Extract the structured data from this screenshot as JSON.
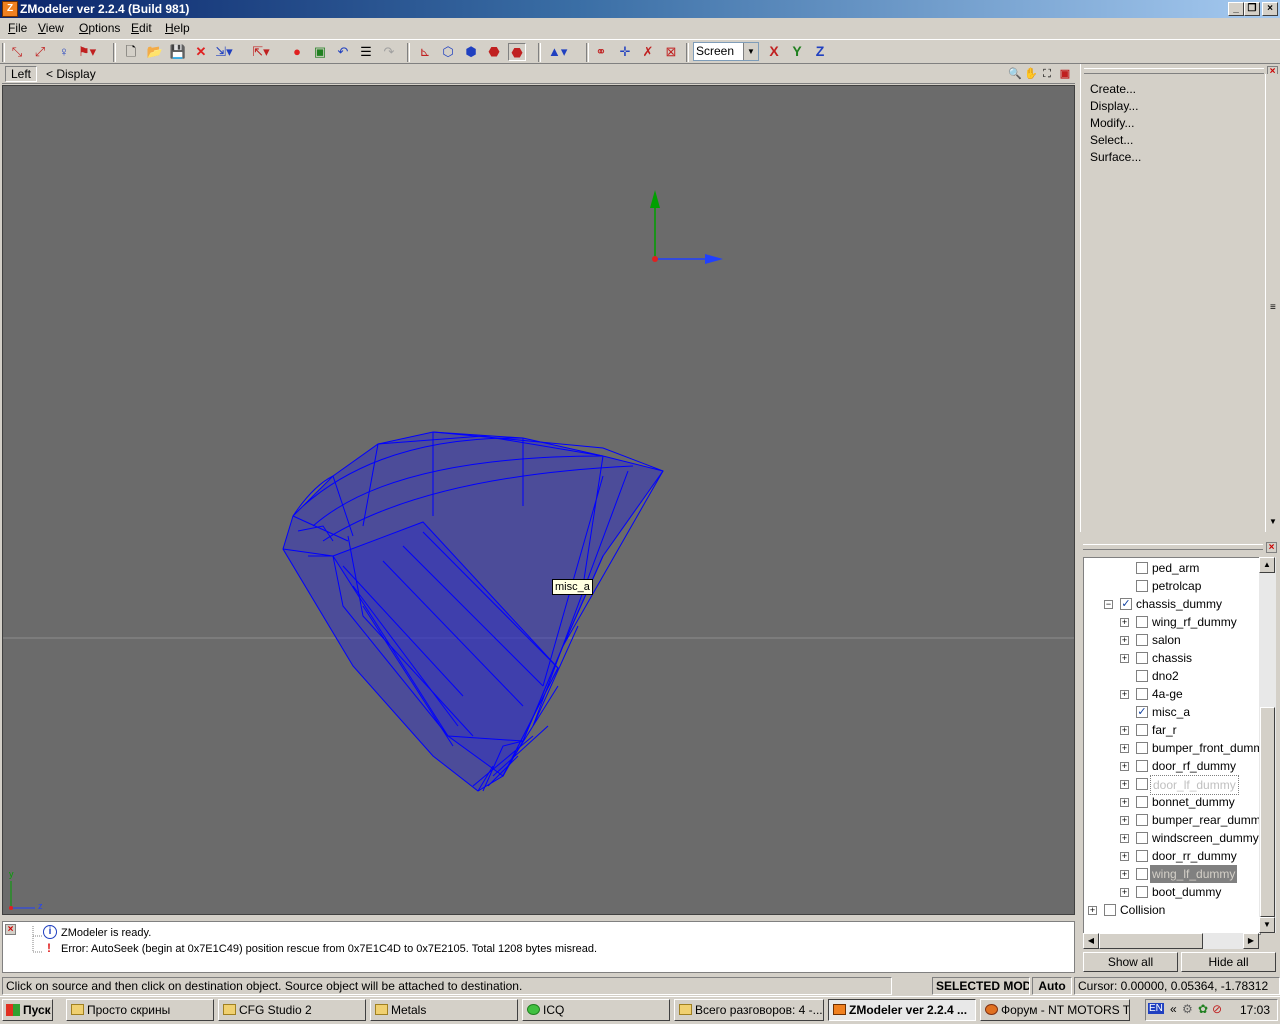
{
  "window": {
    "title": "ZModeler ver 2.2.4 (Build 981)",
    "app_icon": "Z"
  },
  "menu": [
    "File",
    "View",
    "Options",
    "Edit",
    "Help"
  ],
  "toolbar": {
    "screen_value": "Screen",
    "axis_x": "X",
    "axis_y": "Y",
    "axis_z": "Z"
  },
  "viewport": {
    "view_label": "Left",
    "breadcrumb": "<  Display",
    "tooltip": "misc_a",
    "corner_axis_y": "y",
    "corner_axis_z": "z",
    "wire_color": "#0000ff",
    "bg_color": "#6b6b6b"
  },
  "commands": [
    "Create...",
    "Display...",
    "Modify...",
    "Select...",
    "Surface..."
  ],
  "tree": [
    {
      "label": "ped_arm",
      "checked": false,
      "expandable": false,
      "indent": 2,
      "state": ""
    },
    {
      "label": "petrolcap",
      "checked": false,
      "expandable": false,
      "indent": 2,
      "state": ""
    },
    {
      "label": "chassis_dummy",
      "checked": true,
      "expandable": true,
      "expanded": true,
      "indent": 1,
      "state": ""
    },
    {
      "label": "wing_rf_dummy",
      "checked": false,
      "expandable": true,
      "indent": 3,
      "state": ""
    },
    {
      "label": "salon",
      "checked": false,
      "expandable": true,
      "indent": 3,
      "state": ""
    },
    {
      "label": "chassis",
      "checked": false,
      "expandable": true,
      "indent": 3,
      "state": ""
    },
    {
      "label": "dno2",
      "checked": false,
      "expandable": false,
      "indent": 3,
      "state": ""
    },
    {
      "label": "4a-ge",
      "checked": false,
      "expandable": true,
      "indent": 3,
      "state": ""
    },
    {
      "label": "misc_a",
      "checked": true,
      "expandable": false,
      "indent": 3,
      "state": ""
    },
    {
      "label": "far_r",
      "checked": false,
      "expandable": true,
      "indent": 3,
      "state": ""
    },
    {
      "label": "bumper_front_dumm",
      "checked": false,
      "expandable": true,
      "indent": 3,
      "state": ""
    },
    {
      "label": "door_rf_dummy",
      "checked": false,
      "expandable": true,
      "indent": 3,
      "state": ""
    },
    {
      "label": "door_lf_dummy",
      "checked": false,
      "expandable": true,
      "indent": 3,
      "state": "dim"
    },
    {
      "label": "bonnet_dummy",
      "checked": false,
      "expandable": true,
      "indent": 3,
      "state": ""
    },
    {
      "label": "bumper_rear_dumm",
      "checked": false,
      "expandable": true,
      "indent": 3,
      "state": ""
    },
    {
      "label": "windscreen_dummy",
      "checked": false,
      "expandable": true,
      "indent": 3,
      "state": ""
    },
    {
      "label": "door_rr_dummy",
      "checked": false,
      "expandable": true,
      "indent": 3,
      "state": ""
    },
    {
      "label": "wing_lf_dummy",
      "checked": false,
      "expandable": true,
      "indent": 3,
      "state": "sel"
    },
    {
      "label": "boot_dummy",
      "checked": false,
      "expandable": true,
      "indent": 3,
      "state": ""
    },
    {
      "label": "Collision",
      "checked": false,
      "expandable": true,
      "indent": 0,
      "state": ""
    }
  ],
  "buttons": {
    "show_all": "Show all",
    "hide_all": "Hide all"
  },
  "log": [
    {
      "icon": "info-icon",
      "text": "ZModeler is ready."
    },
    {
      "icon": "error-icon",
      "text": "Error: AutoSeek (begin at 0x7E1C49) position rescue  from 0x7E1C4D to 0x7E2105. Total 1208 bytes misread."
    }
  ],
  "status": {
    "hint": "Click on source and then click on destination object. Source object will be attached to destination.",
    "mode": "SELECTED MODE",
    "auto": "Auto",
    "cursor": "Cursor: 0.00000, 0.05364, -1.78312"
  },
  "taskbar": {
    "start": "Пуск",
    "tasks": [
      {
        "label": "Просто скрины",
        "active": false
      },
      {
        "label": "CFG Studio 2",
        "active": false
      },
      {
        "label": "Metals",
        "active": false
      },
      {
        "label": "ICQ",
        "active": false
      },
      {
        "label": "Всего разговоров: 4 -...",
        "active": false
      },
      {
        "label": "ZModeler ver 2.2.4 ...",
        "active": true
      },
      {
        "label": "Форум - NT MOTORS T...",
        "active": false
      }
    ],
    "lang": "EN",
    "clock": "17:03"
  }
}
